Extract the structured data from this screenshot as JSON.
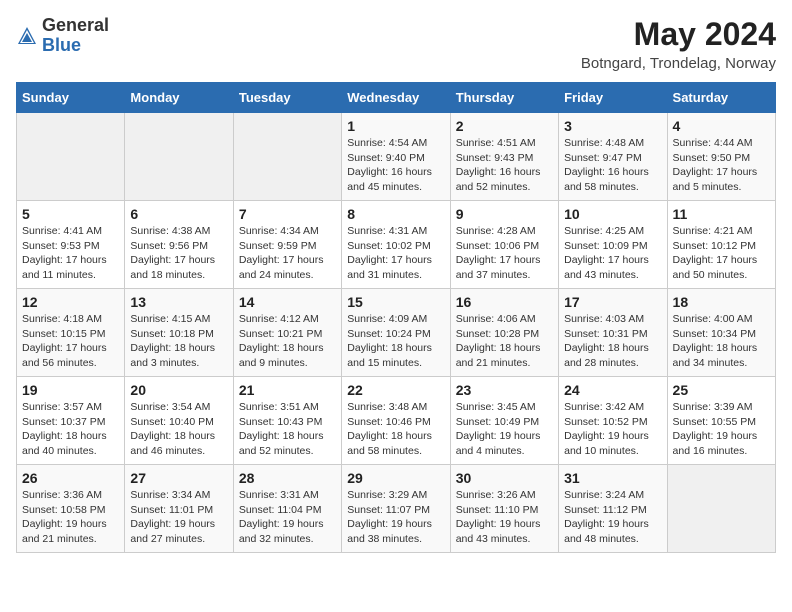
{
  "header": {
    "logo_general": "General",
    "logo_blue": "Blue",
    "title": "May 2024",
    "subtitle": "Botngard, Trondelag, Norway"
  },
  "weekdays": [
    "Sunday",
    "Monday",
    "Tuesday",
    "Wednesday",
    "Thursday",
    "Friday",
    "Saturday"
  ],
  "weeks": [
    [
      {
        "day": "",
        "info": ""
      },
      {
        "day": "",
        "info": ""
      },
      {
        "day": "",
        "info": ""
      },
      {
        "day": "1",
        "info": "Sunrise: 4:54 AM\nSunset: 9:40 PM\nDaylight: 16 hours\nand 45 minutes."
      },
      {
        "day": "2",
        "info": "Sunrise: 4:51 AM\nSunset: 9:43 PM\nDaylight: 16 hours\nand 52 minutes."
      },
      {
        "day": "3",
        "info": "Sunrise: 4:48 AM\nSunset: 9:47 PM\nDaylight: 16 hours\nand 58 minutes."
      },
      {
        "day": "4",
        "info": "Sunrise: 4:44 AM\nSunset: 9:50 PM\nDaylight: 17 hours\nand 5 minutes."
      }
    ],
    [
      {
        "day": "5",
        "info": "Sunrise: 4:41 AM\nSunset: 9:53 PM\nDaylight: 17 hours\nand 11 minutes."
      },
      {
        "day": "6",
        "info": "Sunrise: 4:38 AM\nSunset: 9:56 PM\nDaylight: 17 hours\nand 18 minutes."
      },
      {
        "day": "7",
        "info": "Sunrise: 4:34 AM\nSunset: 9:59 PM\nDaylight: 17 hours\nand 24 minutes."
      },
      {
        "day": "8",
        "info": "Sunrise: 4:31 AM\nSunset: 10:02 PM\nDaylight: 17 hours\nand 31 minutes."
      },
      {
        "day": "9",
        "info": "Sunrise: 4:28 AM\nSunset: 10:06 PM\nDaylight: 17 hours\nand 37 minutes."
      },
      {
        "day": "10",
        "info": "Sunrise: 4:25 AM\nSunset: 10:09 PM\nDaylight: 17 hours\nand 43 minutes."
      },
      {
        "day": "11",
        "info": "Sunrise: 4:21 AM\nSunset: 10:12 PM\nDaylight: 17 hours\nand 50 minutes."
      }
    ],
    [
      {
        "day": "12",
        "info": "Sunrise: 4:18 AM\nSunset: 10:15 PM\nDaylight: 17 hours\nand 56 minutes."
      },
      {
        "day": "13",
        "info": "Sunrise: 4:15 AM\nSunset: 10:18 PM\nDaylight: 18 hours\nand 3 minutes."
      },
      {
        "day": "14",
        "info": "Sunrise: 4:12 AM\nSunset: 10:21 PM\nDaylight: 18 hours\nand 9 minutes."
      },
      {
        "day": "15",
        "info": "Sunrise: 4:09 AM\nSunset: 10:24 PM\nDaylight: 18 hours\nand 15 minutes."
      },
      {
        "day": "16",
        "info": "Sunrise: 4:06 AM\nSunset: 10:28 PM\nDaylight: 18 hours\nand 21 minutes."
      },
      {
        "day": "17",
        "info": "Sunrise: 4:03 AM\nSunset: 10:31 PM\nDaylight: 18 hours\nand 28 minutes."
      },
      {
        "day": "18",
        "info": "Sunrise: 4:00 AM\nSunset: 10:34 PM\nDaylight: 18 hours\nand 34 minutes."
      }
    ],
    [
      {
        "day": "19",
        "info": "Sunrise: 3:57 AM\nSunset: 10:37 PM\nDaylight: 18 hours\nand 40 minutes."
      },
      {
        "day": "20",
        "info": "Sunrise: 3:54 AM\nSunset: 10:40 PM\nDaylight: 18 hours\nand 46 minutes."
      },
      {
        "day": "21",
        "info": "Sunrise: 3:51 AM\nSunset: 10:43 PM\nDaylight: 18 hours\nand 52 minutes."
      },
      {
        "day": "22",
        "info": "Sunrise: 3:48 AM\nSunset: 10:46 PM\nDaylight: 18 hours\nand 58 minutes."
      },
      {
        "day": "23",
        "info": "Sunrise: 3:45 AM\nSunset: 10:49 PM\nDaylight: 19 hours\nand 4 minutes."
      },
      {
        "day": "24",
        "info": "Sunrise: 3:42 AM\nSunset: 10:52 PM\nDaylight: 19 hours\nand 10 minutes."
      },
      {
        "day": "25",
        "info": "Sunrise: 3:39 AM\nSunset: 10:55 PM\nDaylight: 19 hours\nand 16 minutes."
      }
    ],
    [
      {
        "day": "26",
        "info": "Sunrise: 3:36 AM\nSunset: 10:58 PM\nDaylight: 19 hours\nand 21 minutes."
      },
      {
        "day": "27",
        "info": "Sunrise: 3:34 AM\nSunset: 11:01 PM\nDaylight: 19 hours\nand 27 minutes."
      },
      {
        "day": "28",
        "info": "Sunrise: 3:31 AM\nSunset: 11:04 PM\nDaylight: 19 hours\nand 32 minutes."
      },
      {
        "day": "29",
        "info": "Sunrise: 3:29 AM\nSunset: 11:07 PM\nDaylight: 19 hours\nand 38 minutes."
      },
      {
        "day": "30",
        "info": "Sunrise: 3:26 AM\nSunset: 11:10 PM\nDaylight: 19 hours\nand 43 minutes."
      },
      {
        "day": "31",
        "info": "Sunrise: 3:24 AM\nSunset: 11:12 PM\nDaylight: 19 hours\nand 48 minutes."
      },
      {
        "day": "",
        "info": ""
      }
    ]
  ]
}
